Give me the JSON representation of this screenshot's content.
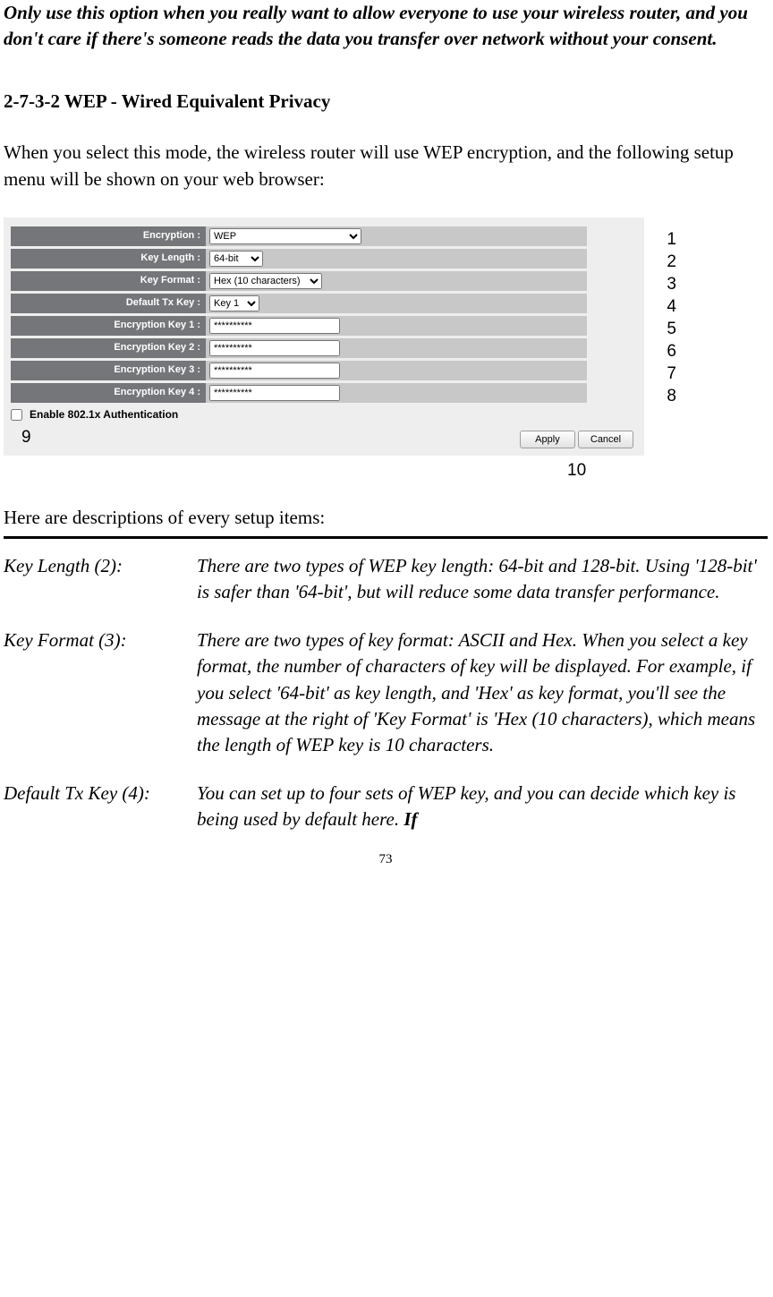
{
  "warning": "Only use this option when you really want to allow everyone to use your wireless router, and you don't care if there's someone reads the data you transfer over network without your consent.",
  "heading": "2-7-3-2 WEP - Wired Equivalent Privacy",
  "intro": "When you select this mode, the wireless router will use WEP encryption, and the following setup menu will be shown on your web browser:",
  "form": {
    "rows": [
      {
        "label": "Encryption :",
        "type": "select",
        "value": "WEP"
      },
      {
        "label": "Key Length :",
        "type": "select",
        "value": "64-bit"
      },
      {
        "label": "Key Format :",
        "type": "select",
        "value": "Hex (10 characters)"
      },
      {
        "label": "Default Tx Key :",
        "type": "select",
        "value": "Key 1"
      },
      {
        "label": "Encryption Key 1 :",
        "type": "text",
        "value": "**********"
      },
      {
        "label": "Encryption Key 2 :",
        "type": "text",
        "value": "**********"
      },
      {
        "label": "Encryption Key 3 :",
        "type": "text",
        "value": "**********"
      },
      {
        "label": "Encryption Key 4 :",
        "type": "text",
        "value": "**********"
      }
    ],
    "auth_label": "Enable 802.1x Authentication",
    "apply": "Apply",
    "cancel": "Cancel"
  },
  "callouts": {
    "c1": "1",
    "c2": "2",
    "c3": "3",
    "c4": "4",
    "c5": "5",
    "c6": "6",
    "c7": "7",
    "c8": "8",
    "c9": "9",
    "c10": "10"
  },
  "desc_intro": "Here are descriptions of every setup items:",
  "items": [
    {
      "name": "Key Length (2):",
      "text": "There are two types of WEP key length: 64-bit and 128-bit. Using '128-bit' is safer than '64-bit', but will reduce some data transfer performance."
    },
    {
      "name": "Key Format (3):",
      "text": "There are two types of key format: ASCII and Hex. When you select a key format, the number of characters of key will be displayed. For example, if you select '64-bit' as key length, and 'Hex' as key format, you'll see the message at the right of 'Key Format' is 'Hex (10 characters), which means the length of WEP key is 10 characters."
    },
    {
      "name": "Default Tx Key (4):",
      "text": "You can set up to four sets of WEP key, and you can decide which key is being used by default here. ",
      "bold": "If"
    }
  ],
  "pageno": "73"
}
